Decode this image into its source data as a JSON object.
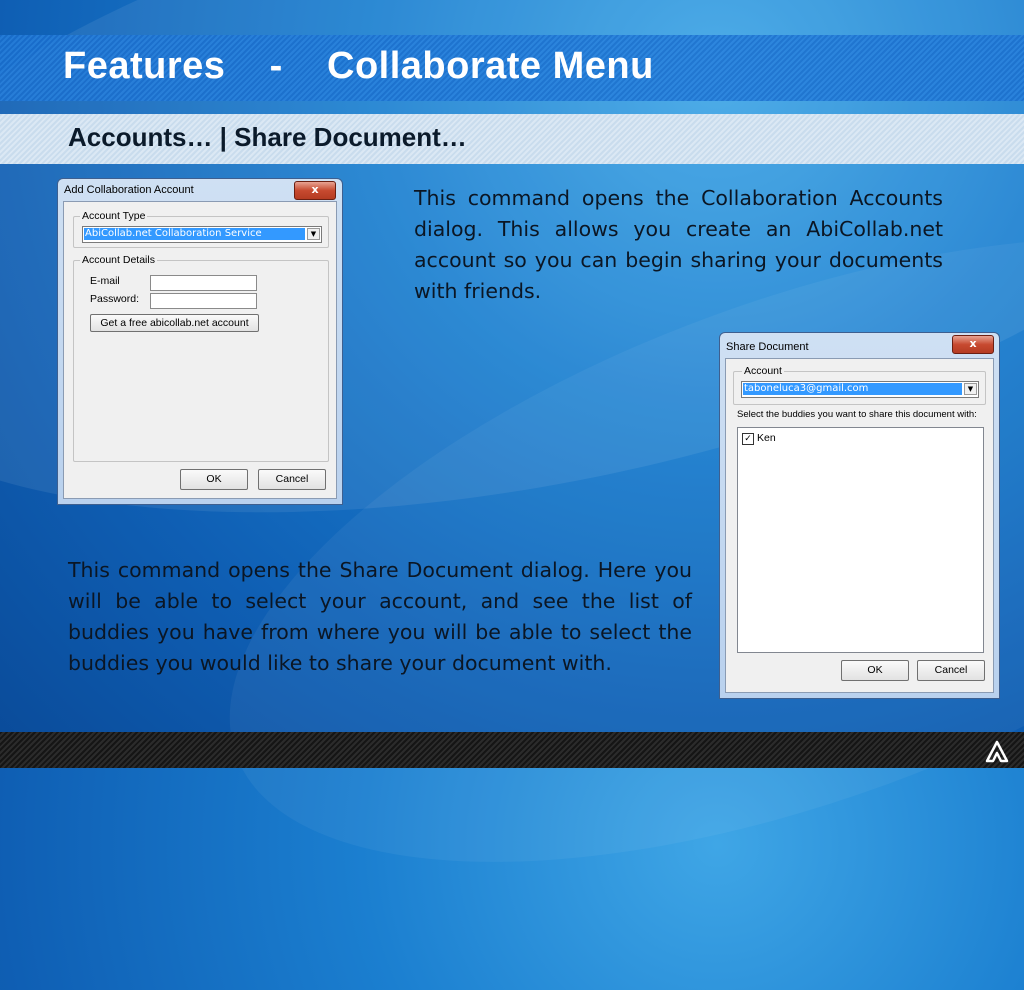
{
  "slide": {
    "title": "Features    -    Collaborate Menu",
    "subtitle": "Accounts… | Share Document…",
    "para1": "This command opens the Collaboration Accounts dialog. This allows you create an AbiCollab.net account so you can begin sharing your documents with friends.",
    "para2": "This command opens the Share Document dialog. Here you will be able to select your account, and see the list of buddies you have from where you will be able to select the buddies you would like to share your document with."
  },
  "add_account_dialog": {
    "title": "Add Collaboration Account",
    "close": "x",
    "account_type_group": "Account Type",
    "account_type_value": "AbiCollab.net Collaboration Service",
    "account_details_group": "Account Details",
    "email_label": "E-mail",
    "email_value": "",
    "password_label": "Password:",
    "password_value": "",
    "get_account_button": "Get a free abicollab.net account",
    "ok": "OK",
    "cancel": "Cancel"
  },
  "share_dialog": {
    "title": "Share Document",
    "close": "x",
    "account_group": "Account",
    "account_value": "taboneluca3@gmail.com",
    "buddies_prompt": "Select the buddies you want to share this document with:",
    "buddies": [
      {
        "name": "Ken",
        "checked": true
      }
    ],
    "ok": "OK",
    "cancel": "Cancel"
  },
  "colors": {
    "background": "#1b7fd0",
    "title_band": "#2880dc",
    "sub_band": "#d3e3f1",
    "select_highlight": "#3399ff",
    "close_button": "#c74a30"
  },
  "icons": {
    "logo": "app-logo-icon",
    "dropdown": "chevron-down-icon",
    "close": "close-icon"
  }
}
